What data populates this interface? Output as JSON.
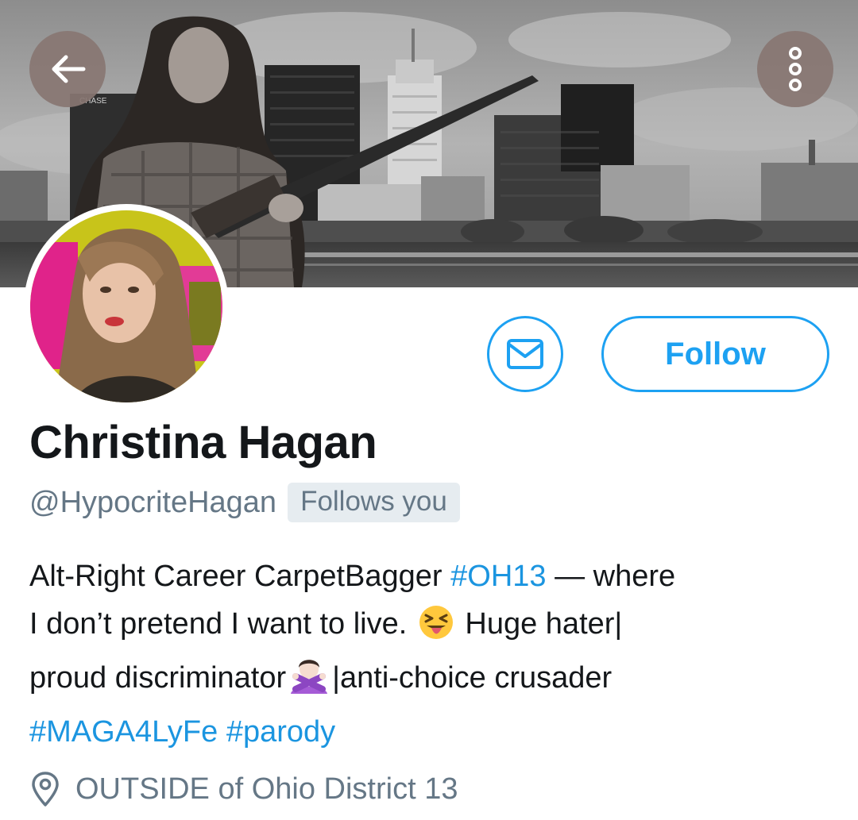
{
  "header": {
    "back_icon": "arrow-left-icon",
    "more_icon": "vertical-dots-icon"
  },
  "banner": {
    "sign_text": "CHASE"
  },
  "actions": {
    "message_icon": "envelope-icon",
    "follow_label": "Follow"
  },
  "profile": {
    "display_name": "Christina Hagan",
    "handle": "@HypocriteHagan",
    "follows_you": "Follows you",
    "bio": {
      "line1_text": "Alt-Right Career CarpetBagger ",
      "line1_hashtag": "#OH13",
      "line1_tail": " — where",
      "line2_text": "I don’t pretend I want to live. ",
      "line2_emoji": "squinting-face-with-tongue",
      "line2_tail": " Huge hater|",
      "line3_text": "proud discriminator",
      "line3_emoji": "person-gesturing-no",
      "line3_tail": "|anti-choice crusader",
      "line4_hashtag1": "#MAGA4LyFe",
      "line4_hashtag2": "#parody"
    },
    "location": "OUTSIDE of Ohio District 13",
    "location_icon": "location-pin-icon"
  },
  "colors": {
    "accent": "#1da1f2",
    "hashtag": "#1b95e0",
    "secondary_text": "#657786",
    "badge_bg": "#e6ecf0"
  }
}
